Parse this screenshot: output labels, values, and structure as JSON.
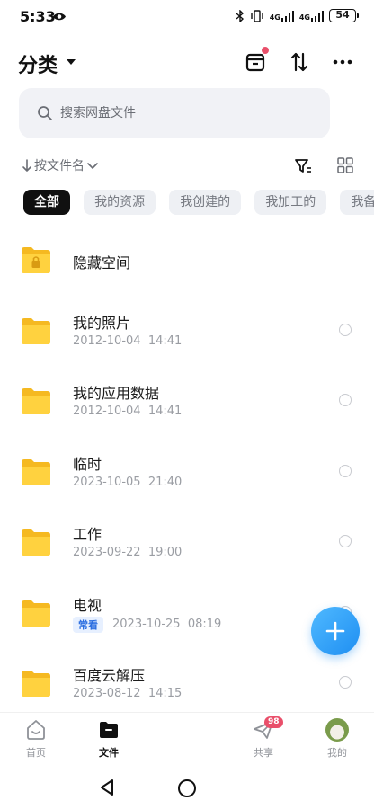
{
  "status_bar": {
    "time": "5:33",
    "network_1": "4G",
    "network_2": "4G",
    "battery": "54"
  },
  "header": {
    "title": "分类"
  },
  "search": {
    "placeholder": "搜索网盘文件"
  },
  "sort": {
    "label": "按文件名"
  },
  "chips": [
    "全部",
    "我的资源",
    "我创建的",
    "我加工的",
    "我备份的"
  ],
  "files": [
    {
      "name": "隐藏空间",
      "date": "",
      "time": "",
      "tag": "",
      "locked": true
    },
    {
      "name": "我的照片",
      "date": "2012-10-04",
      "time": "14:41",
      "tag": ""
    },
    {
      "name": "我的应用数据",
      "date": "2012-10-04",
      "time": "14:41",
      "tag": ""
    },
    {
      "name": "临时",
      "date": "2023-10-05",
      "time": "21:40",
      "tag": ""
    },
    {
      "name": "工作",
      "date": "2023-09-22",
      "time": "19:00",
      "tag": ""
    },
    {
      "name": "电视",
      "date": "2023-10-25",
      "time": "08:19",
      "tag": "常看"
    },
    {
      "name": "百度云解压",
      "date": "2023-08-12",
      "time": "14:15",
      "tag": ""
    }
  ],
  "bottom_nav": {
    "home": "首页",
    "files": "文件",
    "share": "共享",
    "share_badge": "98",
    "mine": "我的"
  },
  "colors": {
    "accent": "#1f8ff2",
    "folder": "#f8c630",
    "badge": "#e94f6a"
  }
}
